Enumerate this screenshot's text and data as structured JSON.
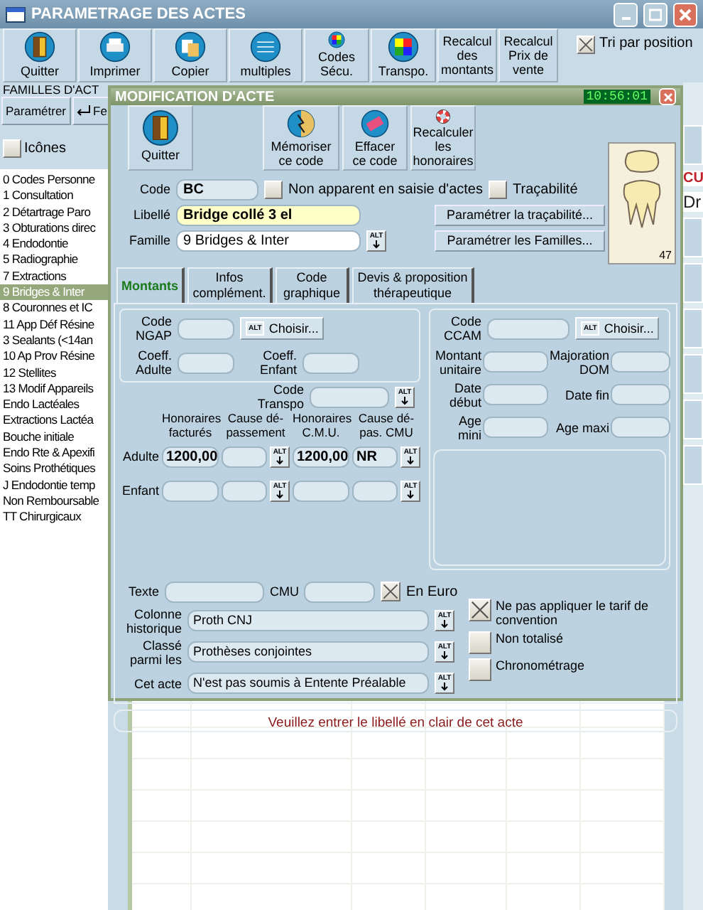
{
  "window": {
    "title": "PARAMETRAGE DES ACTES"
  },
  "toolbar": [
    {
      "label": "Quitter",
      "kind": "icon"
    },
    {
      "label": "Imprimer",
      "kind": "icon"
    },
    {
      "label": "Copier",
      "kind": "icon"
    },
    {
      "label": "multiples",
      "kind": "icon"
    },
    {
      "label": "Codes Sécu.",
      "kind": "icon"
    },
    {
      "label": "Transpo.",
      "kind": "icon"
    },
    {
      "label": "Recalcul des montants",
      "kind": "text"
    },
    {
      "label": "Recalcul Prix de vente",
      "kind": "text"
    }
  ],
  "sort": {
    "label": "Tri par position",
    "checked": true
  },
  "families": {
    "tab": "FAMILLES D'ACT",
    "buttons": [
      "Paramétrer",
      "Fe"
    ],
    "icons_option": {
      "label": "Icônes",
      "checked": false
    },
    "items": [
      {
        "label": "0 Codes Personne",
        "selected": false
      },
      {
        "label": "1 Consultation",
        "selected": false
      },
      {
        "label": "2 Détartrage Paro",
        "selected": false
      },
      {
        "label": "3 Obturations direc",
        "selected": false
      },
      {
        "label": "4 Endodontie",
        "selected": false
      },
      {
        "label": "5 Radiographie",
        "selected": false
      },
      {
        "label": "7 Extractions",
        "selected": false
      },
      {
        "label": "9 Bridges & Inter",
        "selected": true
      },
      {
        "label": "8 Couronnes et IC",
        "selected": false
      },
      {
        "label": "11 App Déf Résine",
        "selected": false
      },
      {
        "label": "3 Sealants (<14an",
        "selected": false
      },
      {
        "label": "10 Ap Prov Résine",
        "selected": false
      },
      {
        "label": "12 Stellites",
        "selected": false
      },
      {
        "label": "13 Modif Appareils",
        "selected": false
      },
      {
        "label": "Endo Lactéales",
        "selected": false
      },
      {
        "label": "Extractions Lactéa",
        "selected": false
      },
      {
        "label": "Bouche initiale",
        "selected": false
      },
      {
        "label": "Endo Rte & Apexifi",
        "selected": false
      },
      {
        "label": "Soins Prothétiques",
        "selected": false
      },
      {
        "label": "J  Endodontie temp",
        "selected": false
      },
      {
        "label": "Non Remboursable",
        "selected": false
      },
      {
        "label": "TT Chirurgicaux",
        "selected": false
      }
    ]
  },
  "background_texts": [
    "CU",
    "Dr"
  ],
  "dialog": {
    "title": "MODIFICATION D'ACTE",
    "clock": "10:56:01",
    "toolbar": [
      {
        "label": "Quitter"
      },
      {
        "label": "Mémoriser ce code"
      },
      {
        "label": "Effacer ce code"
      },
      {
        "label": "Recalculer les honoraires"
      }
    ],
    "tooth_number": "47",
    "code": {
      "label": "Code",
      "value": "BC"
    },
    "flags": [
      {
        "label": "Non apparent en saisie d'actes",
        "checked": false
      },
      {
        "label": "Traçabilité",
        "checked": false
      }
    ],
    "libelle": {
      "label": "Libellé",
      "value": "Bridge collé 3 el",
      "focused": true
    },
    "famille": {
      "label": "Famille",
      "value": "9 Bridges & Inter",
      "picker": "ALT"
    },
    "buttons": [
      "Paramétrer la traçabilité...",
      "Paramétrer les Familles..."
    ],
    "tabs": [
      {
        "label": "Montants",
        "selected": true
      },
      {
        "label": "Infos complément.",
        "selected": false
      },
      {
        "label": "Code graphique",
        "selected": false
      },
      {
        "label": "Devis & proposition thérapeutique",
        "selected": false
      }
    ],
    "ngap": {
      "label": "Code NGAP",
      "picker": "ALT",
      "choose": "Choisir...",
      "coeffs": [
        "Coeff. Adulte",
        "Coeff. Enfant"
      ]
    },
    "ccam": {
      "label": "Code CCAM",
      "picker": "ALT",
      "choose": "Choisir...",
      "fields": [
        "Montant unitaire",
        "Majoration DOM",
        "Date début",
        "Date fin",
        "Age mini",
        "Age maxi"
      ]
    },
    "transpo": {
      "label": "Code Transpo",
      "picker": "ALT"
    },
    "fee_columns": [
      "Honoraires facturés",
      "Cause dé-passement",
      "Honoraires C.M.U.",
      "Cause dé-pas. CMU"
    ],
    "fee_rows": [
      {
        "label": "Adulte",
        "cells": [
          {
            "value": "1200,00"
          },
          {
            "picker": "ALT"
          },
          {
            "value": "1200,00"
          },
          {
            "value": "NR",
            "picker": "ALT"
          }
        ]
      },
      {
        "label": "Enfant",
        "cells": [
          {},
          {
            "picker": "ALT"
          },
          {},
          {
            "picker": "ALT"
          }
        ]
      }
    ],
    "texte_label": "Texte",
    "cmu_label": "CMU",
    "euro": {
      "label": "En Euro",
      "checked": true
    },
    "selects": [
      {
        "label": "Colonne historique",
        "value": "Proth CNJ",
        "picker": "ALT"
      },
      {
        "label": "Classé parmi les",
        "value": "Prothèses conjointes",
        "picker": "ALT"
      },
      {
        "label": "Cet acte",
        "value": "N'est pas soumis à Entente Préalable",
        "picker": "ALT"
      }
    ],
    "options": [
      {
        "label": "Ne pas appliquer le tarif de convention",
        "checked": true
      },
      {
        "label": "Non totalisé",
        "checked": false
      },
      {
        "label": "Chronométrage",
        "checked": false
      }
    ],
    "message": "Veuillez entrer le libellé en clair de cet acte"
  }
}
